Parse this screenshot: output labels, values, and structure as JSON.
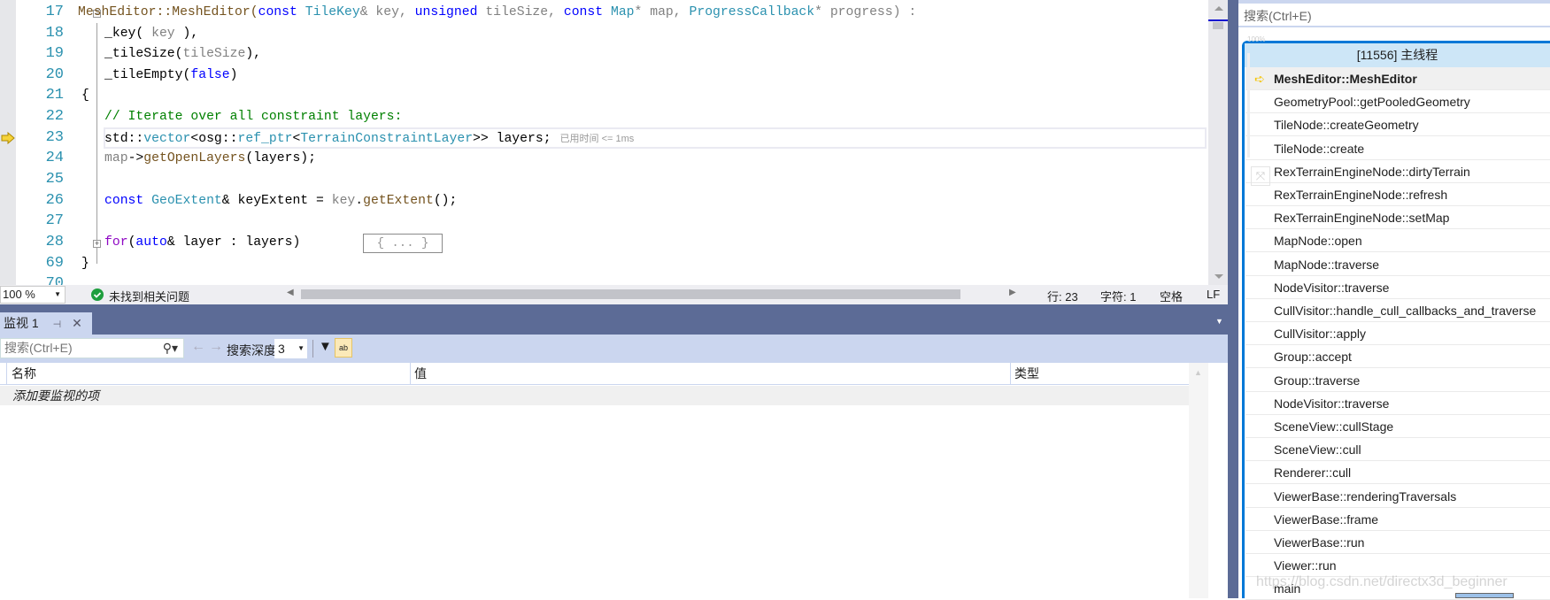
{
  "editor": {
    "line_numbers": [
      "17",
      "18",
      "19",
      "20",
      "21",
      "22",
      "23",
      "24",
      "25",
      "26",
      "27",
      "28",
      "69",
      "70"
    ],
    "current_line_hint": "已用时间 <= 1ms",
    "collapsed_block": "{ ... }",
    "colors": {
      "keyword": "#0000ff",
      "type": "#2b91af",
      "comment": "#008000",
      "parameter": "#808080",
      "function": "#74531f"
    }
  },
  "code": {
    "l17": [
      "MeshEditor::MeshEditor(",
      "const",
      " ",
      "TileKey",
      "& key, ",
      "unsigned",
      " tileSize, ",
      "const",
      " ",
      "Map",
      "* map, ",
      "ProgressCallback",
      "* progress) :"
    ],
    "l18": [
      "_key( ",
      "key",
      " ),"
    ],
    "l19": [
      "_tileSize(",
      "tileSize",
      "),"
    ],
    "l20": [
      "_tileEmpty(",
      "false",
      ")"
    ],
    "l21": "{",
    "l22": "// Iterate over all constraint layers:",
    "l23": [
      "std::",
      "vector",
      "<osg::",
      "ref_ptr",
      "<",
      "TerrainConstraintLayer",
      ">> layers;"
    ],
    "l24": [
      "map",
      "->",
      "getOpenLayers",
      "(layers);"
    ],
    "l26": [
      "const",
      " ",
      "GeoExtent",
      "& keyExtent = ",
      "key",
      ".",
      "getExtent",
      "();"
    ],
    "l28": [
      "for",
      "(",
      "auto",
      "& layer : layers)"
    ],
    "l69": "}"
  },
  "statusbar": {
    "zoom": "100 %",
    "issues": "未找到相关问题",
    "line": "行: 23",
    "char": "字符: 1",
    "whitespace": "空格",
    "eol": "LF"
  },
  "watch": {
    "tab_label": "监视 1",
    "search_placeholder": "搜索(Ctrl+E)",
    "search_depth_label": "搜索深度:",
    "search_depth_value": "3",
    "columns": [
      "名称",
      "值",
      "类型"
    ],
    "add_item": "添加要监视的项"
  },
  "callstack": {
    "search_placeholder": "搜索(Ctrl+E)",
    "zoom_label": "100%",
    "thread_header": "[11556] 主线程",
    "frames": [
      "MeshEditor::MeshEditor",
      "GeometryPool::getPooledGeometry",
      "TileNode::createGeometry",
      "TileNode::create",
      "RexTerrainEngineNode::dirtyTerrain",
      "RexTerrainEngineNode::refresh",
      "RexTerrainEngineNode::setMap",
      "MapNode::open",
      "MapNode::traverse",
      "NodeVisitor::traverse",
      "CullVisitor::handle_cull_callbacks_and_traverse",
      "CullVisitor::apply",
      "Group::accept",
      "Group::traverse",
      "NodeVisitor::traverse",
      "SceneView::cullStage",
      "SceneView::cull",
      "Renderer::cull",
      "ViewerBase::renderingTraversals",
      "ViewerBase::frame",
      "ViewerBase::run",
      "Viewer::run",
      "main"
    ],
    "accent": "#0078d7"
  },
  "watermark": "https://blog.csdn.net/directx3d_beginner"
}
